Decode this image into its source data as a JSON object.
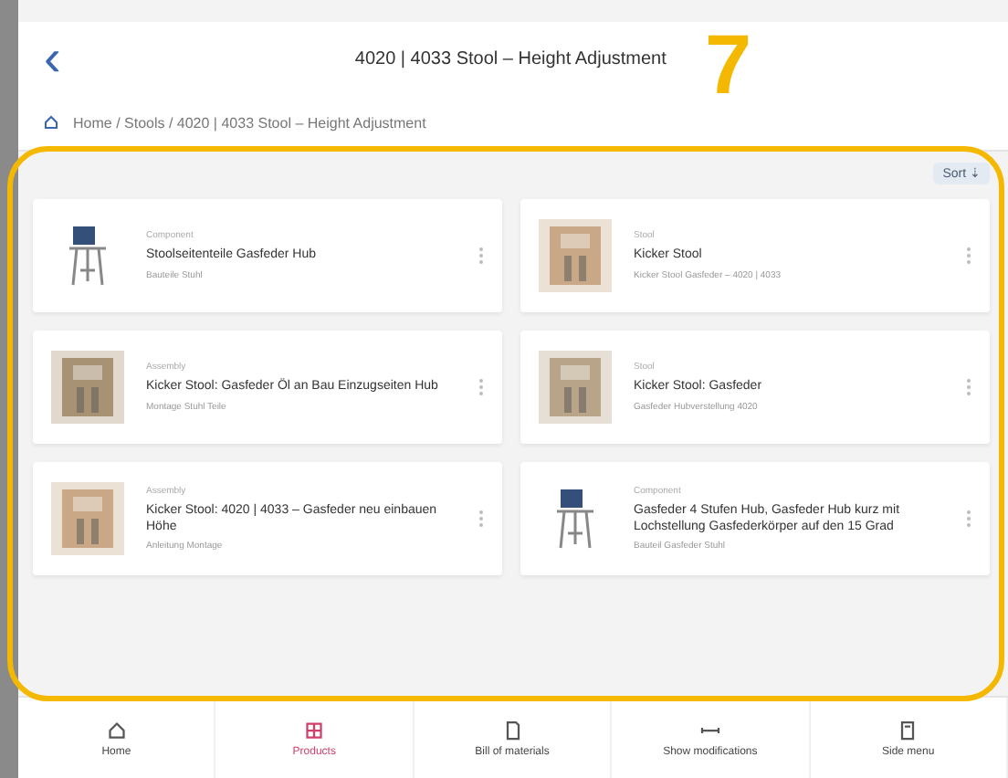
{
  "header": {
    "back": "‹",
    "title": "4020 | 4033 Stool – Height Adjustment"
  },
  "breadcrumb": {
    "text": "Home / Stools / 4020 | 4033 Stool – Height Adjustment"
  },
  "sort": {
    "label": "Sort ⇣"
  },
  "cards": [
    {
      "category": "Component",
      "title": "Stoolseitenteile Gasfeder Hub",
      "subtitle": "Bauteile Stuhl",
      "kind": "drawing"
    },
    {
      "category": "Stool",
      "title": "Kicker Stool",
      "subtitle": "Kicker Stool Gasfeder – 4020 | 4033",
      "kind": "picture"
    },
    {
      "category": "Assembly",
      "title": "Kicker Stool: Gasfeder Öl an Bau Einzugseiten Hub",
      "subtitle": "Montage Stuhl Teile",
      "kind": "picture"
    },
    {
      "category": "Stool",
      "title": "Kicker Stool: Gasfeder",
      "subtitle": "Gasfeder Hubverstellung 4020",
      "kind": "picture"
    },
    {
      "category": "Assembly",
      "title": "Kicker Stool: 4020 | 4033 – Gasfeder neu einbauen Höhe",
      "subtitle": "Anleitung Montage",
      "kind": "picture"
    },
    {
      "category": "Component",
      "title": "Gasfeder 4 Stufen Hub, Gasfeder Hub kurz mit Lochstellung Gasfederkörper auf den 15 Grad",
      "subtitle": "Bauteil Gasfeder Stuhl",
      "kind": "drawing"
    }
  ],
  "nav": [
    {
      "label": "Home",
      "selected": false
    },
    {
      "label": "Products",
      "selected": true
    },
    {
      "label": "Bill of materials",
      "selected": false
    },
    {
      "label": "Show modifications",
      "selected": false
    },
    {
      "label": "Side menu",
      "selected": false
    }
  ],
  "annotation": {
    "label": "7"
  }
}
